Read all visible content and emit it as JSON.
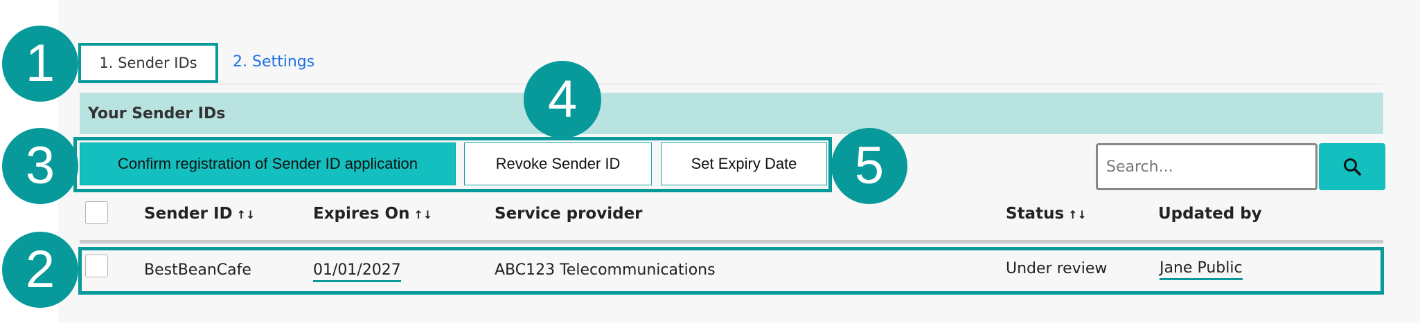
{
  "tabs": [
    {
      "label": "1. Sender IDs",
      "active": true
    },
    {
      "label": "2. Settings",
      "active": false
    }
  ],
  "section": {
    "title": "Your Sender IDs"
  },
  "toolbar": {
    "confirm_label": "Confirm registration of Sender ID application",
    "revoke_label": "Revoke Sender ID",
    "expiry_label": "Set Expiry Date"
  },
  "search": {
    "placeholder": "Search...",
    "icon": "search-icon"
  },
  "table": {
    "sort_glyph": "↑↓",
    "columns": [
      "Sender ID",
      "Expires On",
      "Service provider",
      "Status",
      "Updated by"
    ],
    "rows": [
      {
        "sender_id": "BestBeanCafe",
        "expires_on": "01/01/2027",
        "service_provider": "ABC123 Telecommunications",
        "status": "Under review",
        "updated_by": "Jane Public"
      }
    ]
  },
  "markers": [
    "1",
    "2",
    "3",
    "4",
    "5"
  ],
  "colors": {
    "accent": "#089a9a",
    "button": "#13bfbf",
    "section_bg": "#b8e3e1",
    "link": "#1a73e8"
  }
}
